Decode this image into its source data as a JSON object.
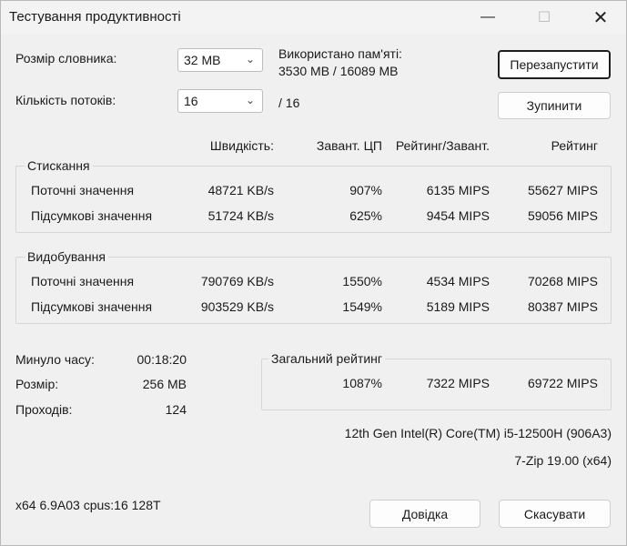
{
  "window": {
    "title": "Тестування продуктивності"
  },
  "controls": {
    "dict_label": "Розмір словника:",
    "dict_value": "32 MB",
    "threads_label": "Кількість потоків:",
    "threads_value": "16",
    "threads_max": "/ 16",
    "memory_label": "Використано пам'яті:",
    "memory_value": "3530 MB / 16089 MB",
    "restart_button": "Перезапустити",
    "stop_button": "Зупинити"
  },
  "headers": {
    "speed": "Швидкість:",
    "cpu": "Завант. ЦП",
    "rating_load": "Рейтинг/Завант.",
    "rating": "Рейтинг"
  },
  "compression": {
    "title": "Стискання",
    "rows": [
      {
        "label": "Поточні значення",
        "speed": "48721 KB/s",
        "cpu": "907%",
        "rating_load": "6135 MIPS",
        "rating": "55627 MIPS"
      },
      {
        "label": "Підсумкові значення",
        "speed": "51724 KB/s",
        "cpu": "625%",
        "rating_load": "9454 MIPS",
        "rating": "59056 MIPS"
      }
    ]
  },
  "decompression": {
    "title": "Видобування",
    "rows": [
      {
        "label": "Поточні значення",
        "speed": "790769 KB/s",
        "cpu": "1550%",
        "rating_load": "4534 MIPS",
        "rating": "70268 MIPS"
      },
      {
        "label": "Підсумкові значення",
        "speed": "903529 KB/s",
        "cpu": "1549%",
        "rating_load": "5189 MIPS",
        "rating": "80387 MIPS"
      }
    ]
  },
  "stats": {
    "elapsed_label": "Минуло часу:",
    "elapsed_value": "00:18:20",
    "size_label": "Розмір:",
    "size_value": "256 MB",
    "passes_label": "Проходів:",
    "passes_value": "124"
  },
  "total": {
    "title": "Загальний рейтинг",
    "cpu": "1087%",
    "rating_load": "7322 MIPS",
    "rating": "69722 MIPS"
  },
  "system": {
    "cpu_name": "12th Gen Intel(R) Core(TM) i5-12500H (906A3)",
    "version": "7-Zip 19.00 (x64)",
    "arch": "x64 6.9A03 cpus:16 128T"
  },
  "footer": {
    "help_button": "Довідка",
    "cancel_button": "Скасувати"
  }
}
